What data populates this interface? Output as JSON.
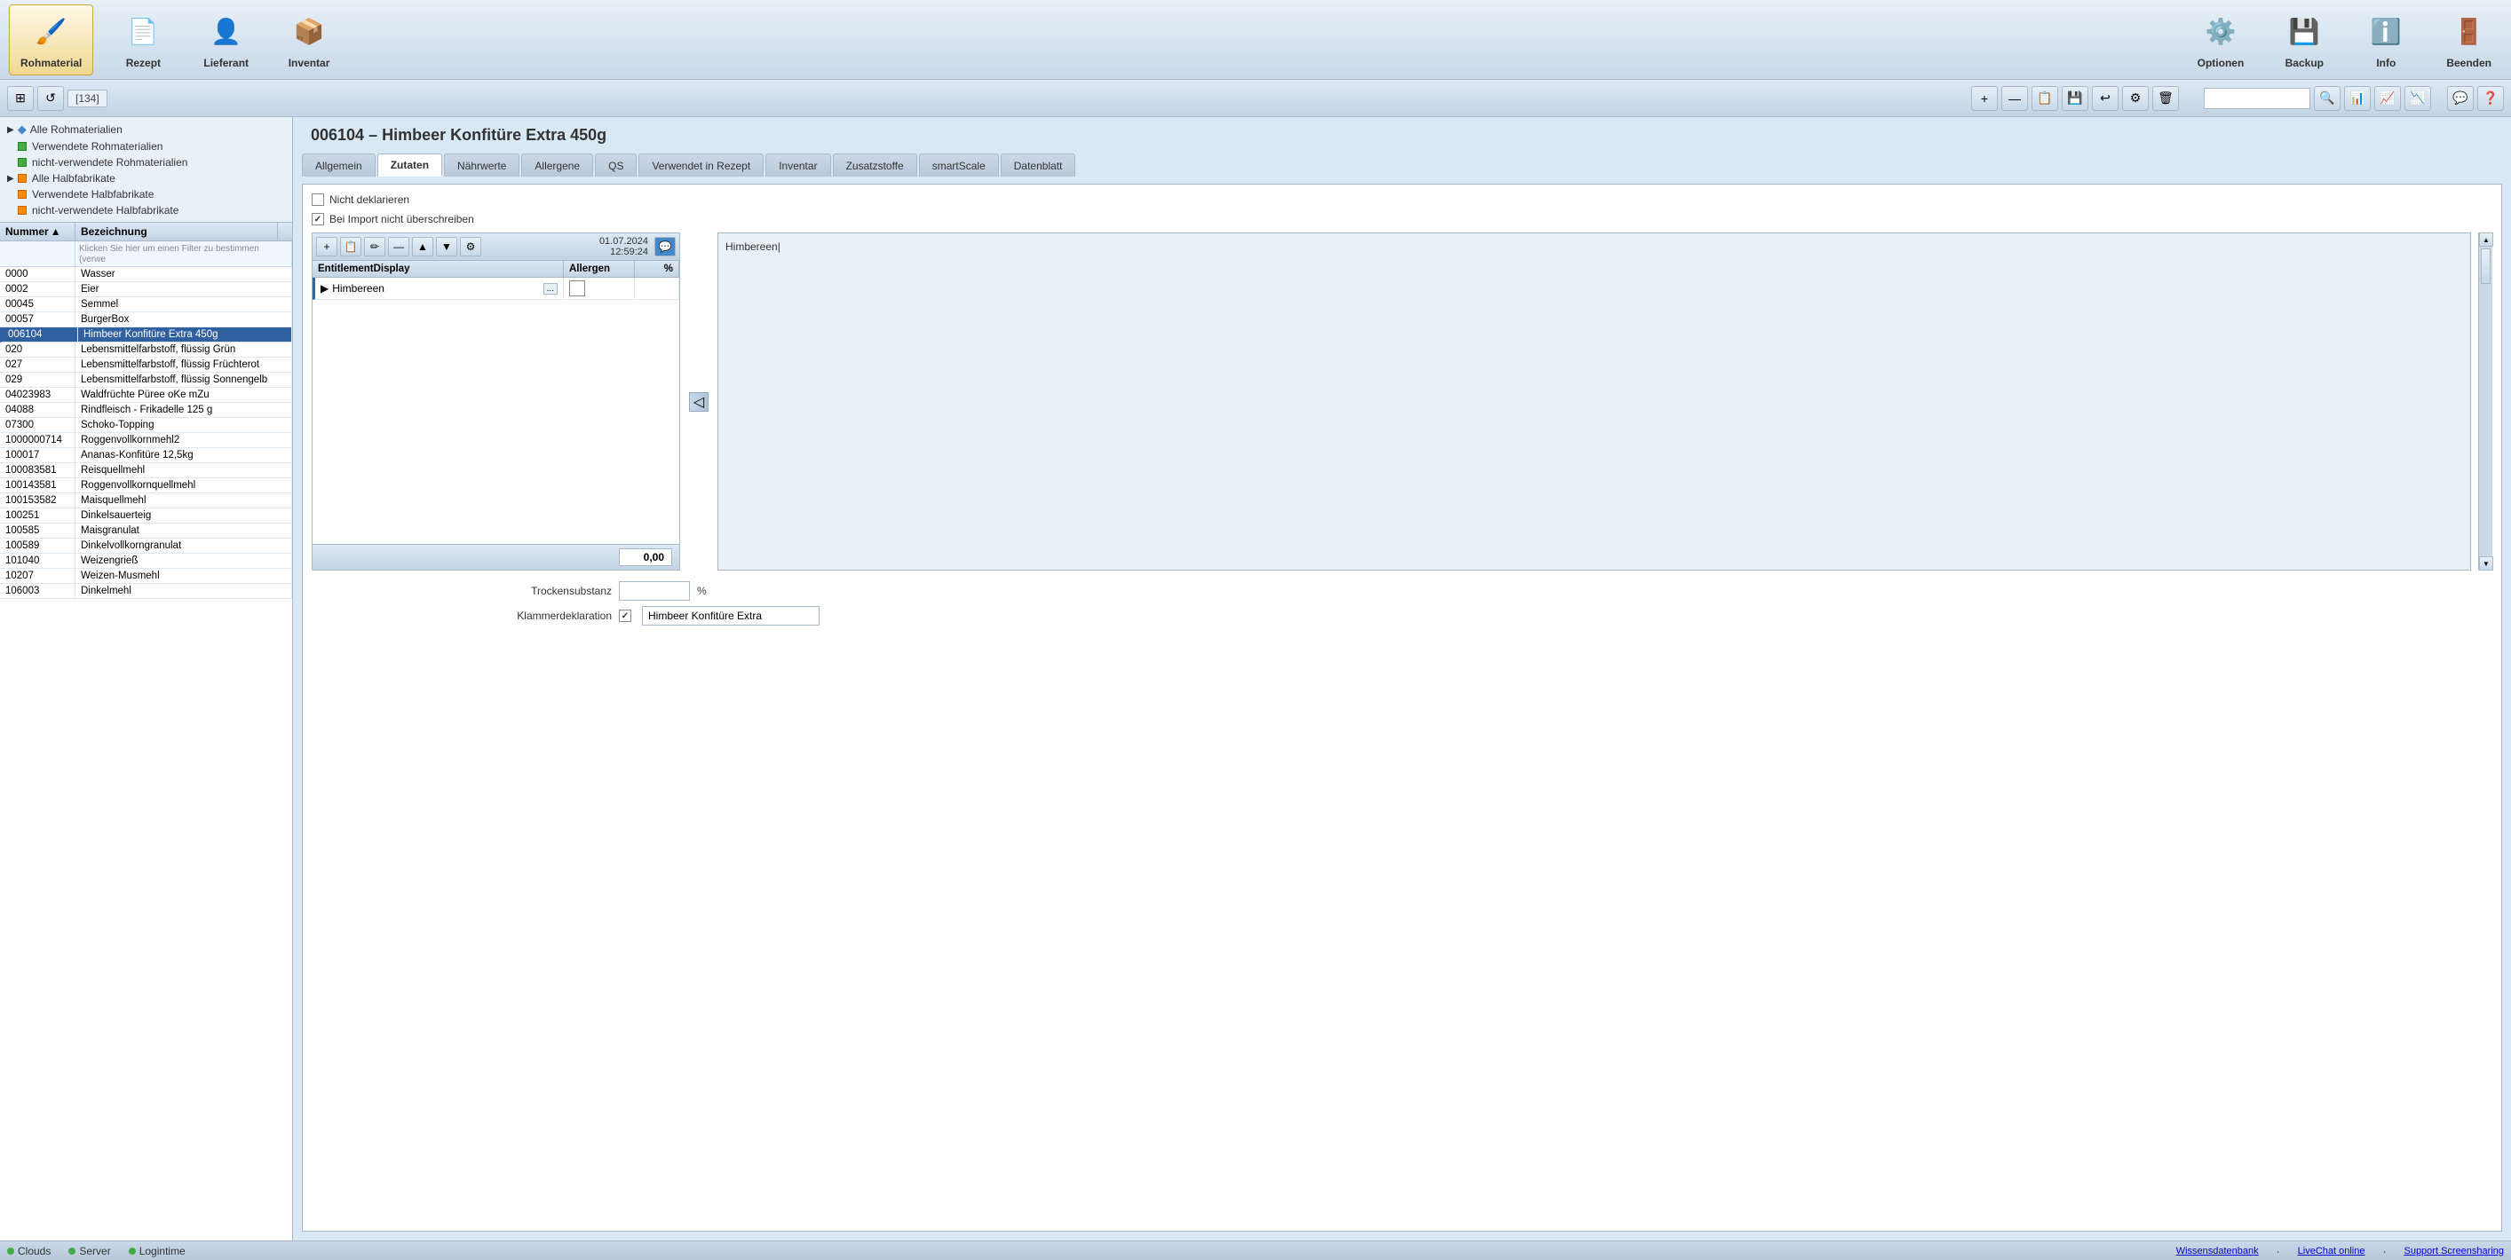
{
  "app": {
    "title": "006104 – Himbeer Konfitüre Extra 450g"
  },
  "top_toolbar": {
    "buttons": [
      {
        "id": "rohmaterial",
        "label": "Rohmaterial",
        "icon": "🖌️",
        "active": true
      },
      {
        "id": "rezept",
        "label": "Rezept",
        "icon": "📄",
        "active": false
      },
      {
        "id": "lieferant",
        "label": "Lieferant",
        "icon": "👤",
        "active": false
      },
      {
        "id": "inventar",
        "label": "Inventar",
        "icon": "📦",
        "active": false
      }
    ],
    "right_buttons": [
      {
        "id": "optionen",
        "label": "Optionen",
        "icon": "⚙️"
      },
      {
        "id": "backup",
        "label": "Backup",
        "icon": "💾"
      },
      {
        "id": "info",
        "label": "Info",
        "icon": "ℹ️"
      },
      {
        "id": "beenden",
        "label": "Beenden",
        "icon": "🚪"
      }
    ]
  },
  "secondary_toolbar": {
    "counter": "[134]",
    "buttons": [
      "⊞",
      "↺",
      "📋",
      "💾",
      "↩",
      "⚙",
      "🗑"
    ]
  },
  "left_panel": {
    "tree_items": [
      {
        "label": "Alle Rohmaterialien",
        "icon": "🔷",
        "indent": 0
      },
      {
        "label": "Verwendete Rohmaterialien",
        "icon": "🟢",
        "indent": 1
      },
      {
        "label": "nicht-verwendete Rohmaterialien",
        "icon": "🟢",
        "indent": 1
      },
      {
        "label": "Alle Halbfabrikate",
        "icon": "🟠",
        "indent": 0
      },
      {
        "label": "Verwendete Halbfabrikate",
        "icon": "🟠",
        "indent": 1
      },
      {
        "label": "nicht-verwendete Halbfabrikate",
        "icon": "🟠",
        "indent": 1
      }
    ],
    "table_headers": [
      {
        "id": "nummer",
        "label": "Nummer",
        "sort": "▲"
      },
      {
        "id": "bezeichnung",
        "label": "Bezeichnung"
      }
    ],
    "filter_placeholder": "Klicken Sie hier um einen Filter zu bestimmen (verwe",
    "data_rows": [
      {
        "nummer": "0000",
        "bezeichnung": "Wasser",
        "selected": false
      },
      {
        "nummer": "0002",
        "bezeichnung": "Eier",
        "selected": false
      },
      {
        "nummer": "00045",
        "bezeichnung": "Semmel",
        "selected": false
      },
      {
        "nummer": "00057",
        "bezeichnung": "BurgerBox",
        "selected": false
      },
      {
        "nummer": "006104",
        "bezeichnung": "Himbeer Konfitüre Extra 450g",
        "selected": true
      },
      {
        "nummer": "020",
        "bezeichnung": "Lebensmittelfarbstoff, flüssig Grün",
        "selected": false
      },
      {
        "nummer": "027",
        "bezeichnung": "Lebensmittelfarbstoff, flüssig Früchterot",
        "selected": false
      },
      {
        "nummer": "029",
        "bezeichnung": "Lebensmittelfarbstoff, flüssig Sonnengelb",
        "selected": false
      },
      {
        "nummer": "04023983",
        "bezeichnung": "Waldfrüchte Püree oKe mZu",
        "selected": false
      },
      {
        "nummer": "04088",
        "bezeichnung": "Rindfleisch - Frikadelle 125 g",
        "selected": false
      },
      {
        "nummer": "07300",
        "bezeichnung": "Schoko-Topping",
        "selected": false
      },
      {
        "nummer": "1000000714",
        "bezeichnung": "Roggenvollkornmehl2",
        "selected": false
      },
      {
        "nummer": "100017",
        "bezeichnung": "Ananas-Konfitüre 12,5kg",
        "selected": false
      },
      {
        "nummer": "100083581",
        "bezeichnung": "Reisquellmehl",
        "selected": false
      },
      {
        "nummer": "100143581",
        "bezeichnung": "Roggenvollkornquellmehl",
        "selected": false
      },
      {
        "nummer": "100153582",
        "bezeichnung": "Maisquellmehl",
        "selected": false
      },
      {
        "nummer": "100251",
        "bezeichnung": "Dinkelsauerteig",
        "selected": false
      },
      {
        "nummer": "100585",
        "bezeichnung": "Maisgranulat",
        "selected": false
      },
      {
        "nummer": "100589",
        "bezeichnung": "Dinkelvollkorngranulat",
        "selected": false
      },
      {
        "nummer": "101040",
        "bezeichnung": "Weizengrieß",
        "selected": false
      },
      {
        "nummer": "10207",
        "bezeichnung": "Weizen-Musmehl",
        "selected": false
      },
      {
        "nummer": "106003",
        "bezeichnung": "Dinkelmehl",
        "selected": false
      }
    ]
  },
  "right_panel": {
    "title": "006104 – Himbeer Konfitüre Extra 450g",
    "tabs": [
      {
        "id": "allgemein",
        "label": "Allgemein"
      },
      {
        "id": "zutaten",
        "label": "Zutaten",
        "active": true
      },
      {
        "id": "naehrwerte",
        "label": "Nährwerte"
      },
      {
        "id": "allergene",
        "label": "Allergene"
      },
      {
        "id": "qs",
        "label": "QS"
      },
      {
        "id": "verwendet_in_rezept",
        "label": "Verwendet in Rezept"
      },
      {
        "id": "inventar",
        "label": "Inventar"
      },
      {
        "id": "zusatzstoffe",
        "label": "Zusatzstoffe"
      },
      {
        "id": "smartscale",
        "label": "smartScale"
      },
      {
        "id": "datenblatt",
        "label": "Datenblatt"
      }
    ],
    "checkboxes": [
      {
        "id": "nicht_deklarieren",
        "label": "Nicht deklarieren",
        "checked": false
      },
      {
        "id": "bei_import",
        "label": "Bei Import nicht überschreiben",
        "checked": true
      }
    ],
    "inner_toolbar": {
      "datetime": "01.07.2024\n12:59:24",
      "buttons": [
        "+",
        "📋",
        "✏",
        "—",
        "▲",
        "▼",
        "⚙",
        "💬"
      ]
    },
    "inner_table": {
      "headers": [
        "EntitlementDisplay",
        "Allergen",
        "%"
      ],
      "rows": [
        {
          "entitlement": "Himbereen",
          "allergen": "",
          "pct": ""
        }
      ],
      "total": "0,00"
    },
    "description_text": "Himbereen",
    "description_cursor": true,
    "trockensubstanz_label": "Trockensubstanz",
    "trockensubstanz_value": "",
    "trockensubstanz_unit": "%",
    "klammerdeklaration_label": "Klammerdeklaration",
    "klammerdeklaration_checked": true,
    "klammerdeklaration_value": "Himbeer Konfitüre Extra"
  },
  "status_bar": {
    "items": [
      {
        "label": "Clouds",
        "color": "#44aa44"
      },
      {
        "label": "Server",
        "color": "#44aa44"
      },
      {
        "label": "Logintime",
        "color": "#44aa44"
      },
      {
        "label": "Wissensdatenbank",
        "url": true
      },
      {
        "label": "LiveChat online",
        "url": true
      },
      {
        "label": "Support Screensharing",
        "url": true
      }
    ]
  }
}
